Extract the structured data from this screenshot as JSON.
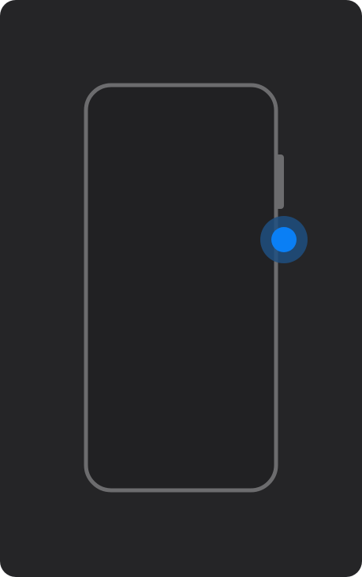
{
  "illustration": {
    "device": "phone-outline",
    "highlighted_control": "side-button",
    "icons": [
      "phone-outline-icon",
      "side-button-icon",
      "tap-indicator-icon"
    ]
  },
  "colors": {
    "card_background": "#252527",
    "phone_screen": "#212123",
    "phone_outline": "#6c6c6e",
    "side_button": "#6c6c6e",
    "indicator_dot": "#0a7ff5",
    "indicator_halo": "#1e4f80"
  }
}
